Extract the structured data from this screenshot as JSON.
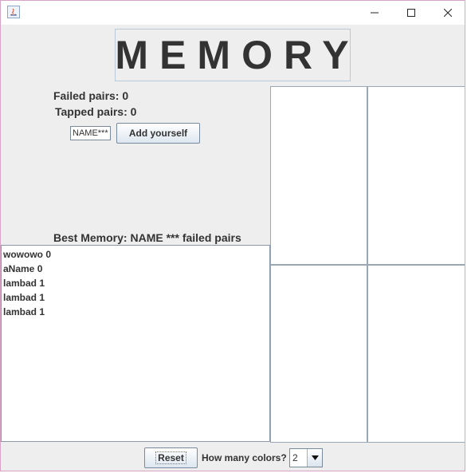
{
  "window": {
    "controls": {
      "minimize": "—",
      "maximize": "☐",
      "close": "✕"
    },
    "icon": "java-icon"
  },
  "game": {
    "title": "MEMORY",
    "failed_pairs": "Failed pairs: 0",
    "tapped_pairs": "Tapped pairs: 0",
    "name_input_value": "NAME***",
    "add_button_label": "Add yourself",
    "best_memory": "Best Memory: NAME *** failed pairs"
  },
  "scores": [
    "wowowo 0",
    "aName 0",
    "lambad 1",
    "lambad 1",
    "lambad 1"
  ],
  "footer": {
    "reset_label": "Reset",
    "colors_label": "How many colors?",
    "colors_value": "2"
  }
}
